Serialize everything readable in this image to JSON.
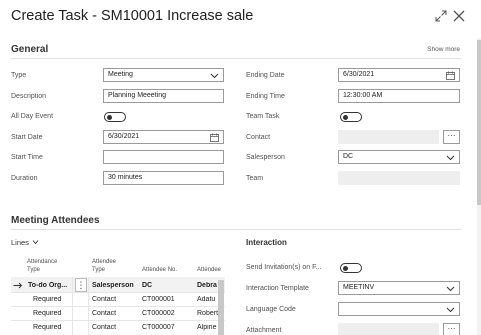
{
  "window": {
    "title": "Create Task - SM10001 Increase sale",
    "expand_icon": "expand-icon",
    "close_icon": "close-icon"
  },
  "general": {
    "section_title": "General",
    "show_more": "Show more",
    "type": {
      "label": "Type",
      "value": "Meeting"
    },
    "description": {
      "label": "Description",
      "value": "Planning Meeeting"
    },
    "all_day_event": {
      "label": "All Day Event",
      "value": false
    },
    "start_date": {
      "label": "Start Date",
      "value": "6/30/2021"
    },
    "start_time": {
      "label": "Start Time",
      "value": ""
    },
    "duration": {
      "label": "Duration",
      "value": "30 minutes"
    },
    "ending_date": {
      "label": "Ending Date",
      "value": "6/30/2021"
    },
    "ending_time": {
      "label": "Ending Time",
      "value": "12:30:00 AM"
    },
    "team_task": {
      "label": "Team Task",
      "value": false
    },
    "contact": {
      "label": "Contact",
      "value": ""
    },
    "salesperson": {
      "label": "Salesperson",
      "value": "DC"
    },
    "team": {
      "label": "Team",
      "value": ""
    }
  },
  "attendees": {
    "section_title": "Meeting Attendees",
    "lines_label": "Lines",
    "columns": {
      "attendance_type_1": "Attendance",
      "attendance_type_2": "Type",
      "attendee_type_1": "Attendee",
      "attendee_type_2": "Type",
      "attendee_no": "Attendee No.",
      "attendee_name": "Attendee"
    },
    "rows": [
      {
        "attendance_type": "To-do Org...",
        "attendee_type": "Salesperson",
        "attendee_no": "DC",
        "attendee_name": "Debra",
        "bold": true
      },
      {
        "attendance_type": "Required",
        "attendee_type": "Contact",
        "attendee_no": "CT000001",
        "attendee_name": "Adatu"
      },
      {
        "attendance_type": "Required",
        "attendee_type": "Contact",
        "attendee_no": "CT000002",
        "attendee_name": "Robert"
      },
      {
        "attendance_type": "Required",
        "attendee_type": "Contact",
        "attendee_no": "CT000007",
        "attendee_name": "Alpine"
      }
    ]
  },
  "interaction": {
    "section_title": "Interaction",
    "send_invitations": {
      "label": "Send Invitation(s) on F...",
      "value": false
    },
    "interaction_template": {
      "label": "Interaction Template",
      "value": "MEETINV"
    },
    "language_code": {
      "label": "Language Code",
      "value": ""
    },
    "attachment": {
      "label": "Attachment",
      "value": ""
    }
  }
}
